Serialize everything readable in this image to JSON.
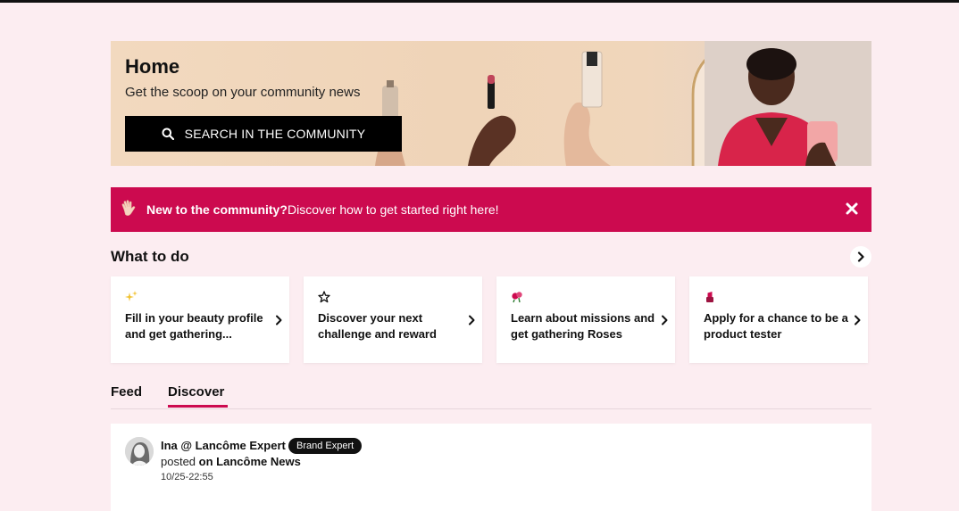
{
  "hero": {
    "title": "Home",
    "subtitle": "Get the scoop on your community news",
    "search_button": "SEARCH IN THE COMMUNITY"
  },
  "banner": {
    "bold_text": "New to the community?",
    "text": "Discover how to get started right here!",
    "icon": "waving-hand-icon",
    "close_icon": "close-icon",
    "color": "#cc0a4f"
  },
  "what_to_do": {
    "title": "What to do",
    "cards": [
      {
        "icon": "sparkles-icon",
        "label": "Fill in your beauty profile and get gathering..."
      },
      {
        "icon": "star-icon",
        "label": "Discover your next challenge and reward"
      },
      {
        "icon": "roses-icon",
        "label": "Learn about missions and get gathering Roses"
      },
      {
        "icon": "lipstick-icon",
        "label": "Apply for a chance to be a product tester"
      }
    ]
  },
  "tabs": {
    "items": [
      "Feed",
      "Discover"
    ],
    "active": "Discover"
  },
  "post": {
    "author": "Ina @ Lancôme Expert",
    "badge": "Brand Expert",
    "posted_prefix": "posted",
    "posted_location": "on Lancôme News",
    "timestamp": "10/25-22:55"
  },
  "colors": {
    "accent": "#cc0a4f",
    "background": "#fcedf1"
  }
}
